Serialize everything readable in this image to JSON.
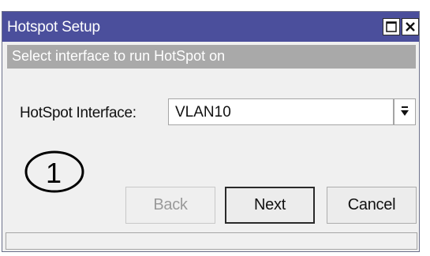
{
  "window": {
    "title": "Hotspot Setup"
  },
  "hint": {
    "text": "Select interface to run HotSpot on"
  },
  "form": {
    "interface_label": "HotSpot Interface:",
    "interface_value": "VLAN10"
  },
  "annotation": {
    "step_number": "1"
  },
  "buttons": {
    "back_label": "Back",
    "next_label": "Next",
    "cancel_label": "Cancel"
  },
  "status": {
    "text": ""
  },
  "icons": {
    "maximize": "maximize-icon",
    "close": "close-icon",
    "dropdown": "dropdown-arrow-icon"
  },
  "colors": {
    "titlebar": "#4b4f9c",
    "hint_bar": "#a9a9a9"
  }
}
